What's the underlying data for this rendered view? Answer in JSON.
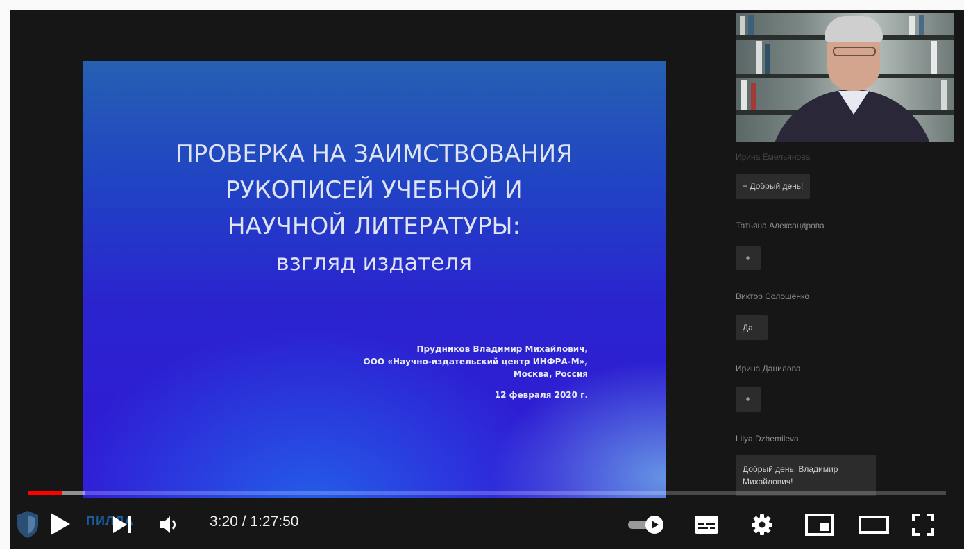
{
  "video": {
    "current_time": "3:20",
    "separator": "/",
    "duration": "1:27:50",
    "progress_played_fraction": 0.038,
    "progress_loaded_fraction": 0.062,
    "watermark_text": "ПИЛЛА"
  },
  "slide": {
    "title_lines": [
      "ПРОВЕРКА НА ЗАИМСТВОВАНИЯ",
      "РУКОПИСЕЙ УЧЕБНОЙ И",
      "НАУЧНОЙ ЛИТЕРАТУРЫ:",
      "взгляд издателя"
    ],
    "author": "Прудников Владимир Михайлович,",
    "organization": "ООО «Научно-издательский центр ИНФРА-М»,",
    "location": "Москва, Россия",
    "date": "12 февраля 2020 г."
  },
  "chat": [
    {
      "name": "Ирина Емельянова",
      "message": "+ Добрый день!"
    },
    {
      "name": "Татьяна Александрова",
      "message": "+"
    },
    {
      "name": "Виктор Солошенко",
      "message": "Да"
    },
    {
      "name": "Ирина Данилова",
      "message": "+"
    },
    {
      "name": "Lilya Dzhemileva",
      "message": "Добрый день, Владимир Михайлович!"
    }
  ],
  "controls": {
    "play": "play-icon",
    "next": "next-icon",
    "volume": "volume-icon",
    "autoplay": "autoplay-toggle-icon",
    "subtitles": "subtitles-icon",
    "settings": "gear-icon",
    "miniplayer": "miniplayer-icon",
    "theater": "theater-icon",
    "fullscreen": "fullscreen-icon"
  },
  "colors": {
    "progress_played": "#ff0000",
    "player_bg": "#161616",
    "slide_blue": "#2a24cf"
  }
}
